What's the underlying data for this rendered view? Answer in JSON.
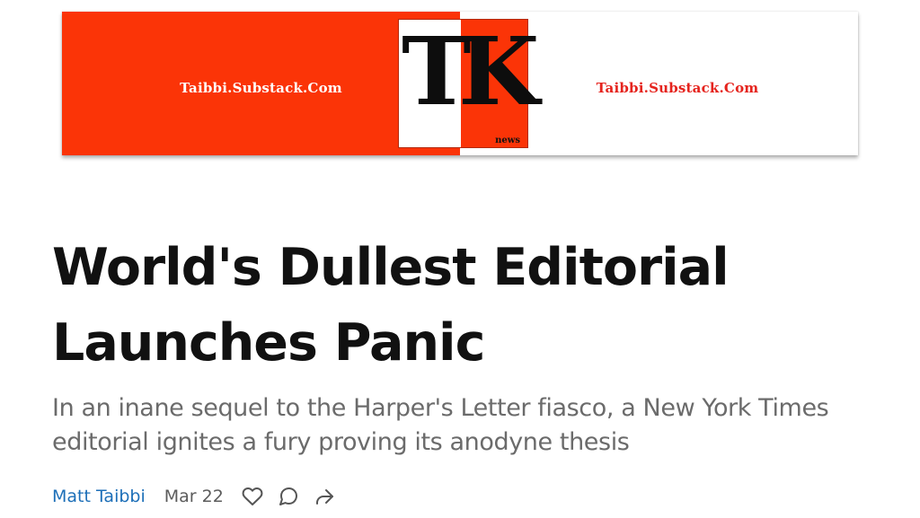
{
  "banner": {
    "left_url_text": "Taibbi.Substack.Com",
    "right_url_text": "Taibbi.Substack.Com",
    "logo_letter_1": "T",
    "logo_letter_2": "K",
    "logo_small_text": "news",
    "colors": {
      "brand_red": "#fb3407",
      "right_text_red": "#e5231d"
    }
  },
  "post": {
    "title": "World's Dullest Editorial Launches Panic",
    "subtitle": "In an inane sequel to the Harper's Letter fiasco, a New York Times editorial ignites a fury proving its anodyne thesis",
    "author": "Matt Taibbi",
    "date": "Mar 22",
    "actions": [
      "heart-icon",
      "comment-icon",
      "share-icon"
    ]
  }
}
